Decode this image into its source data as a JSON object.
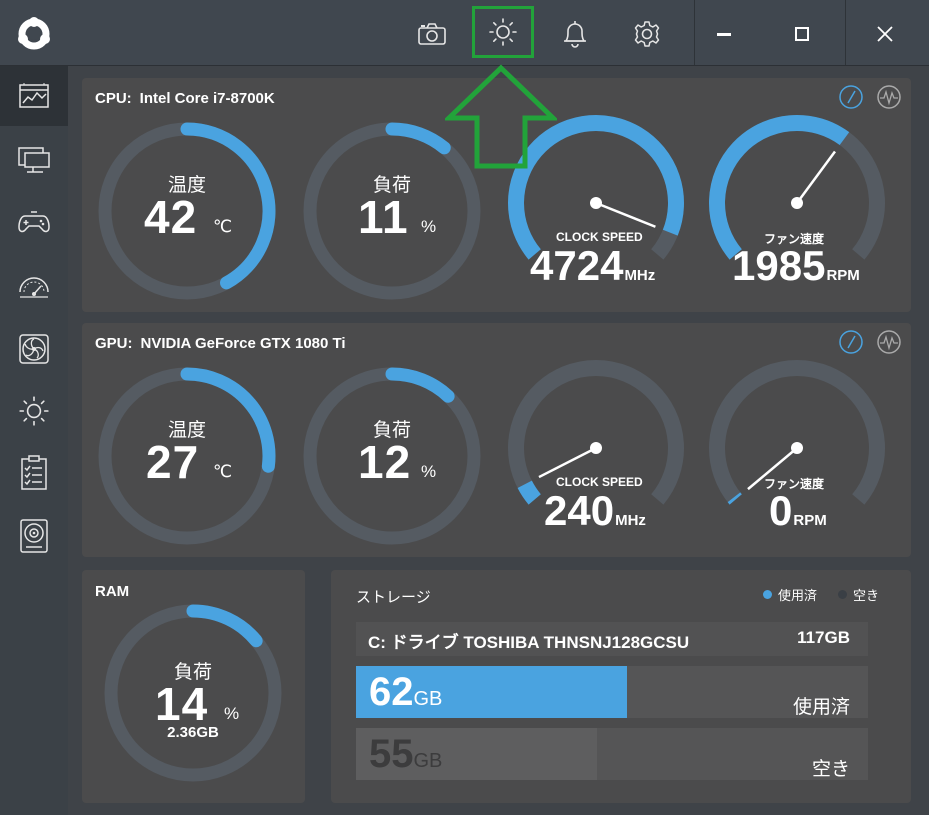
{
  "colors": {
    "accent": "#4aa3e0",
    "track": "#555b62",
    "highlight": "#22a33a"
  },
  "titlebar": {
    "icons": [
      "camera-icon",
      "brightness-icon",
      "bell-icon",
      "gear-icon",
      "minimize-icon",
      "maximize-icon",
      "close-icon"
    ]
  },
  "sidebar": {
    "items": [
      "dashboard-icon",
      "monitor-icon",
      "gamepad-icon",
      "speedometer-icon",
      "fan-icon",
      "brightness-icon",
      "checklist-icon",
      "disk-icon"
    ]
  },
  "cpu": {
    "label": "CPU:",
    "model": "Intel Core i7-8700K",
    "temp": {
      "label": "温度",
      "value": "42",
      "unit": "℃",
      "fraction": 0.42
    },
    "load": {
      "label": "負荷",
      "value": "11",
      "unit": "%",
      "fraction": 0.11
    },
    "clock": {
      "label": "CLOCK SPEED",
      "value": "4724",
      "unit": "MHz",
      "fraction": 0.93
    },
    "fan": {
      "label": "ファン速度",
      "value": "1985",
      "unit": "RPM",
      "fraction": 0.64
    }
  },
  "gpu": {
    "label": "GPU:",
    "model": "NVIDIA GeForce GTX 1080 Ti",
    "temp": {
      "label": "温度",
      "value": "27",
      "unit": "℃",
      "fraction": 0.27
    },
    "load": {
      "label": "負荷",
      "value": "12",
      "unit": "%",
      "fraction": 0.12
    },
    "clock": {
      "label": "CLOCK SPEED",
      "value": "240",
      "unit": "MHz",
      "fraction": 0.05
    },
    "fan": {
      "label": "ファン速度",
      "value": "0",
      "unit": "RPM",
      "fraction": 0.0
    }
  },
  "ram": {
    "label": "RAM",
    "load_label": "負荷",
    "value": "14",
    "unit": "%",
    "used": "2.36GB",
    "fraction": 0.14
  },
  "storage": {
    "title": "ストレージ",
    "legend_used": "使用済",
    "legend_free": "空き",
    "drive_name": "C: ドライブ TOSHIBA THNSNJ128GCSU",
    "drive_total": "117GB",
    "used_value": "62",
    "used_unit": "GB",
    "used_label": "使用済",
    "used_fraction": 0.53,
    "free_value": "55",
    "free_unit": "GB",
    "free_label": "空き",
    "free_fraction": 0.47
  }
}
